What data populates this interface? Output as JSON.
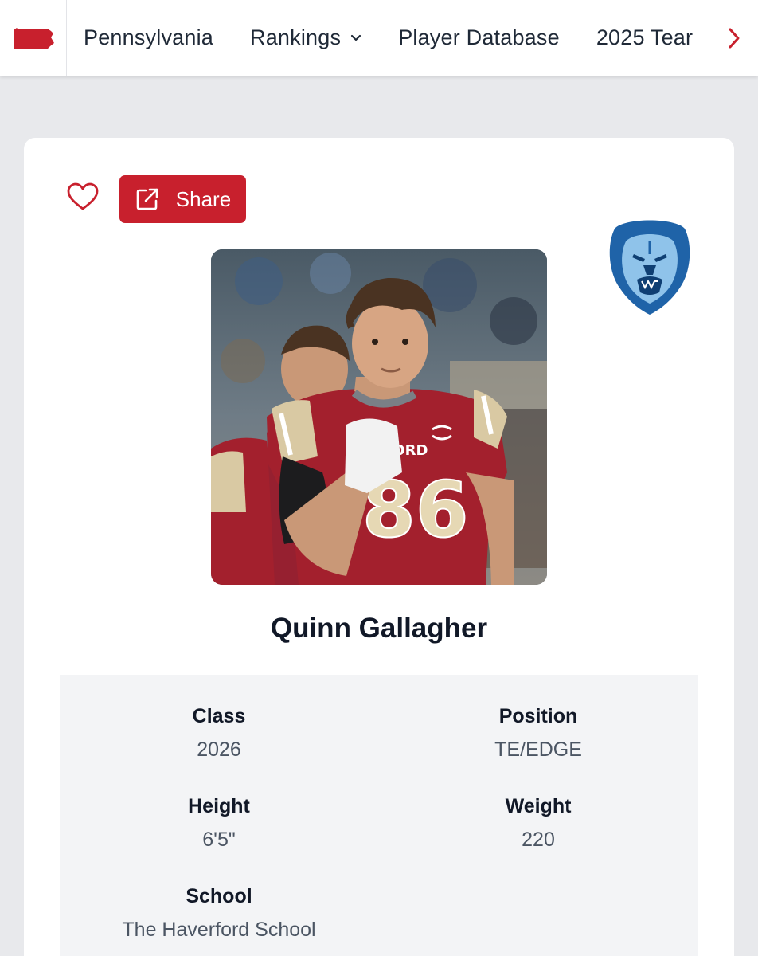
{
  "nav": {
    "state": "Pennsylvania",
    "items": [
      {
        "label": "Rankings"
      },
      {
        "label": "Player Database"
      },
      {
        "label": "2025 Tear"
      }
    ]
  },
  "actions": {
    "share_label": "Share"
  },
  "player": {
    "name": "Quinn Gallagher",
    "jersey_number": "86",
    "jersey_text": "FORD",
    "class_label": "Class",
    "class_value": "2026",
    "position_label": "Position",
    "position_value": "TE/EDGE",
    "height_label": "Height",
    "height_value": "6'5\"",
    "weight_label": "Weight",
    "weight_value": "220",
    "school_label": "School",
    "school_value": "The Haverford School"
  },
  "icons": {
    "state": "pennsylvania-state-icon",
    "chevron_down": "chevron-down-icon",
    "next": "chevron-right-icon",
    "favorite": "heart-icon",
    "share": "external-link-icon",
    "team": "lion-logo-icon"
  },
  "colors": {
    "accent": "#c8202d",
    "team_blue": "#1f63a8",
    "team_light_blue": "#8fc3ea",
    "jersey_maroon": "#a3202d",
    "page_bg": "#e8e9ec",
    "details_bg": "#f3f4f6"
  }
}
